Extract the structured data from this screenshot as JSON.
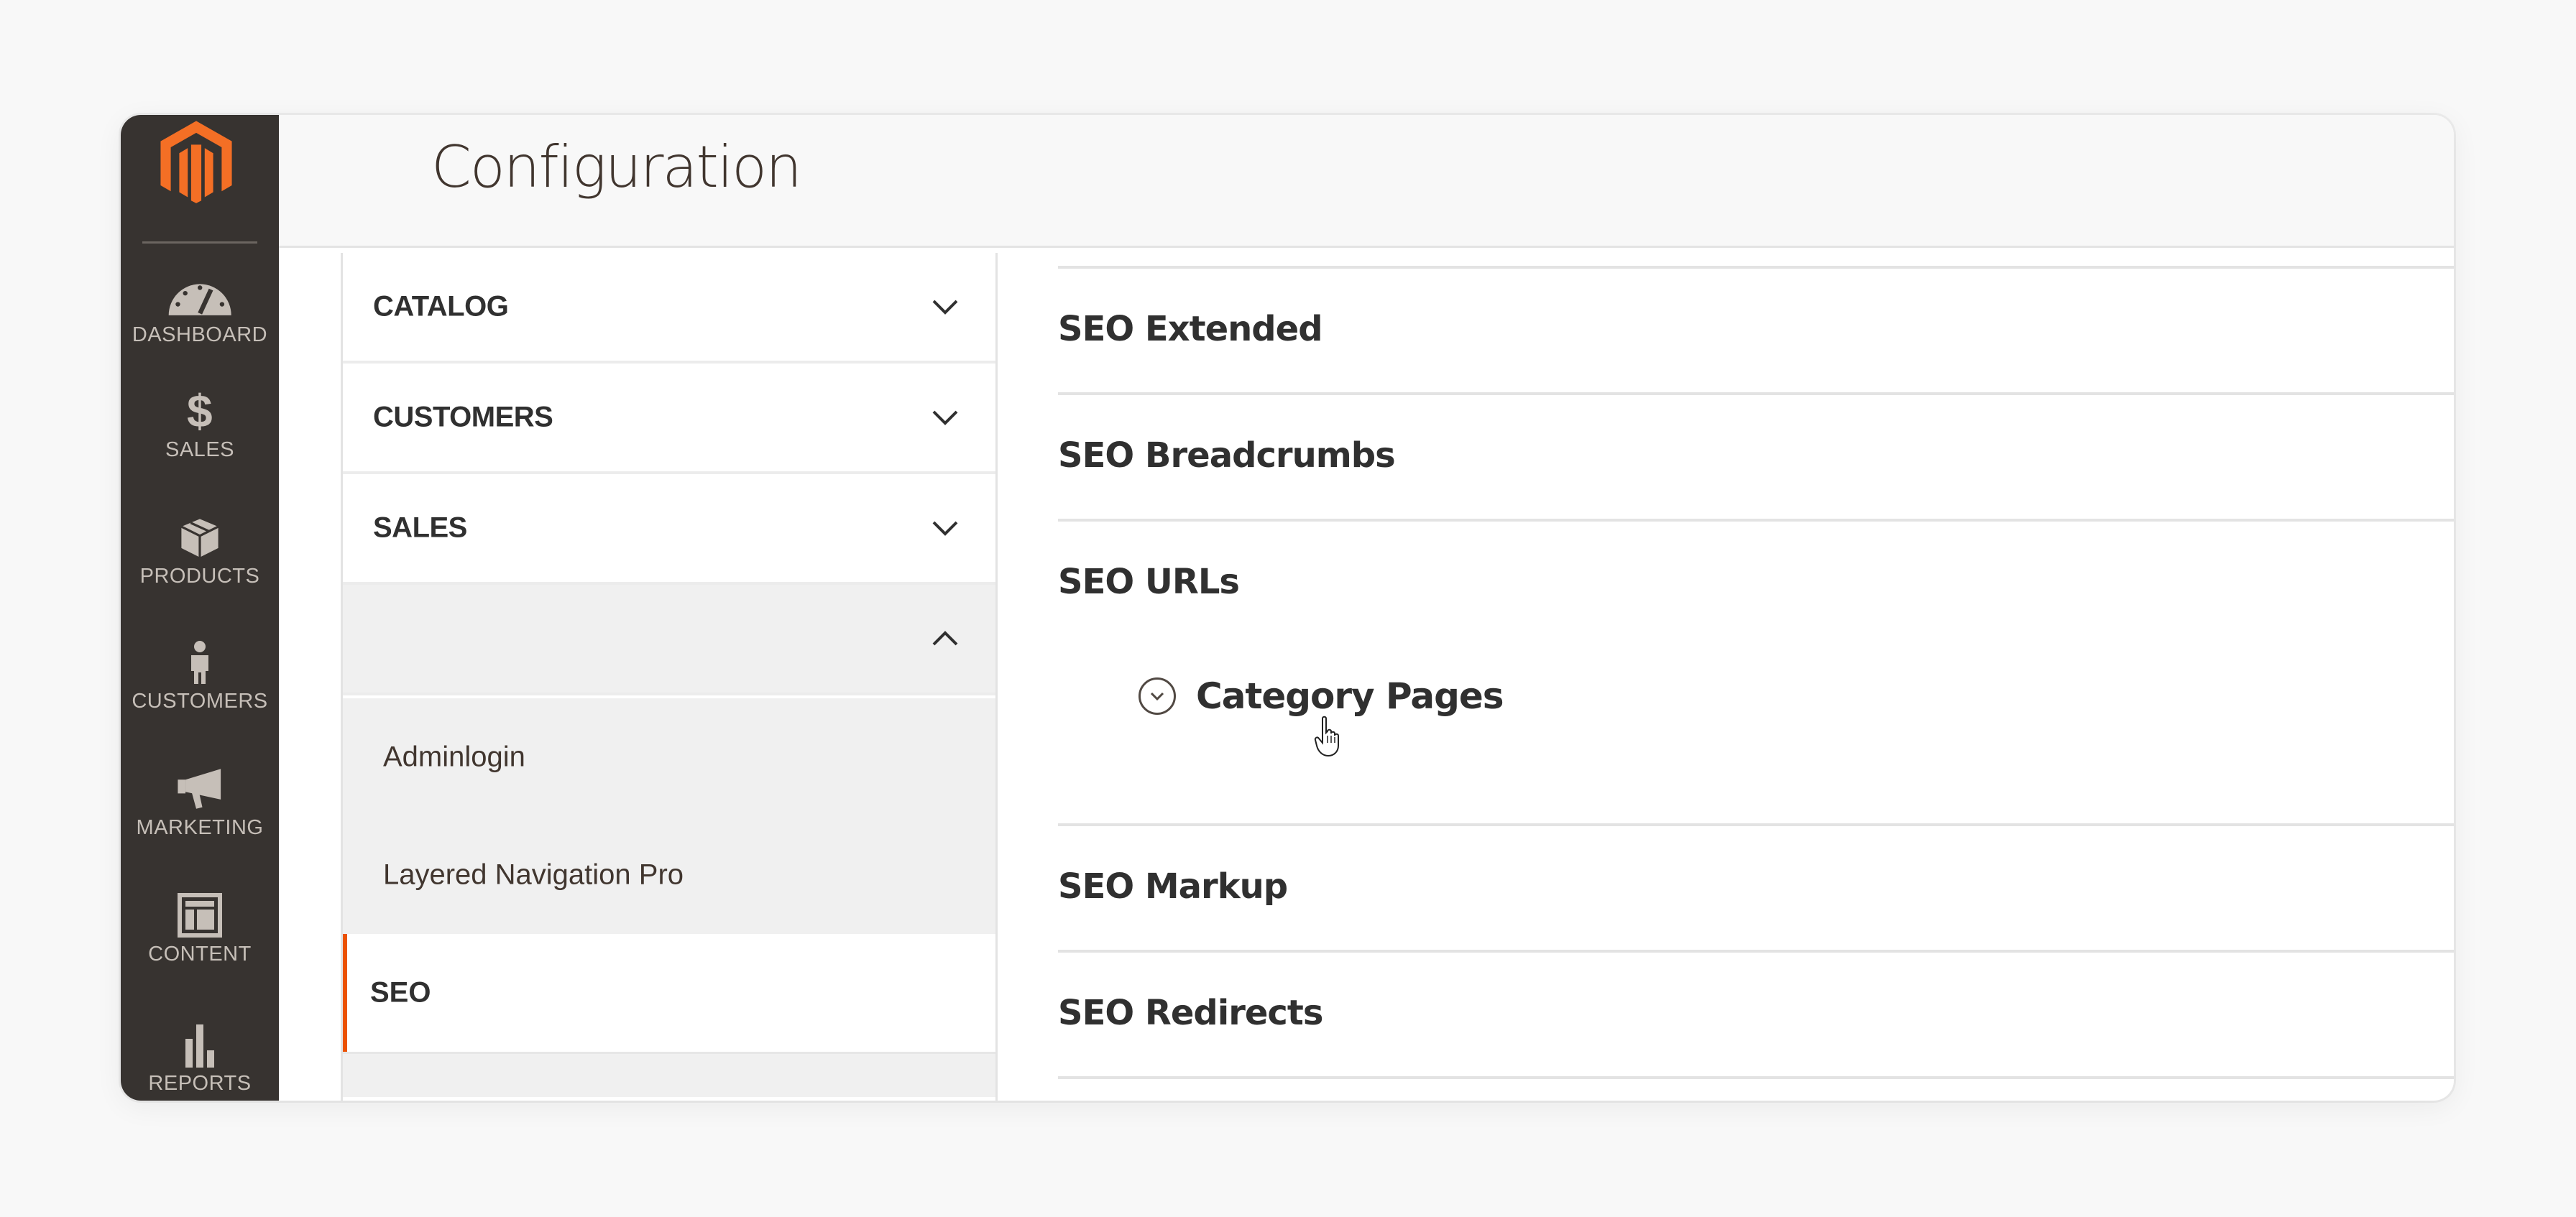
{
  "colors": {
    "brand_orange": "#eb5202",
    "sidebar_bg": "#373330",
    "sidebar_text": "#c6bfb8"
  },
  "sidebar": {
    "logo": "magento-logo",
    "items": [
      {
        "label": "DASHBOARD",
        "icon": "dashboard-gauge-icon"
      },
      {
        "label": "SALES",
        "icon": "dollar-icon"
      },
      {
        "label": "PRODUCTS",
        "icon": "box-icon"
      },
      {
        "label": "CUSTOMERS",
        "icon": "person-icon"
      },
      {
        "label": "MARKETING",
        "icon": "megaphone-icon"
      },
      {
        "label": "CONTENT",
        "icon": "layout-icon"
      },
      {
        "label": "REPORTS",
        "icon": "bar-chart-icon"
      }
    ]
  },
  "header": {
    "title": "Configuration"
  },
  "config_tabs": {
    "groups": [
      {
        "label": "CATALOG",
        "state": "collapsed"
      },
      {
        "label": "CUSTOMERS",
        "state": "collapsed"
      },
      {
        "label": "SALES",
        "state": "collapsed"
      },
      {
        "label": "",
        "state": "expanded"
      }
    ],
    "subitems": [
      {
        "label": "Adminlogin",
        "active": false
      },
      {
        "label": "Layered Navigation Pro",
        "active": false
      },
      {
        "label": "SEO",
        "active": true
      }
    ]
  },
  "sections": [
    {
      "title": "SEO Extended"
    },
    {
      "title": "SEO Breadcrumbs"
    },
    {
      "title": "SEO URLs",
      "expanded": true,
      "subsections": [
        {
          "title": "Category Pages",
          "icon": "expand-circle-icon"
        }
      ]
    },
    {
      "title": "SEO Markup"
    },
    {
      "title": "SEO Redirects"
    }
  ],
  "cursor": "hand-pointer"
}
